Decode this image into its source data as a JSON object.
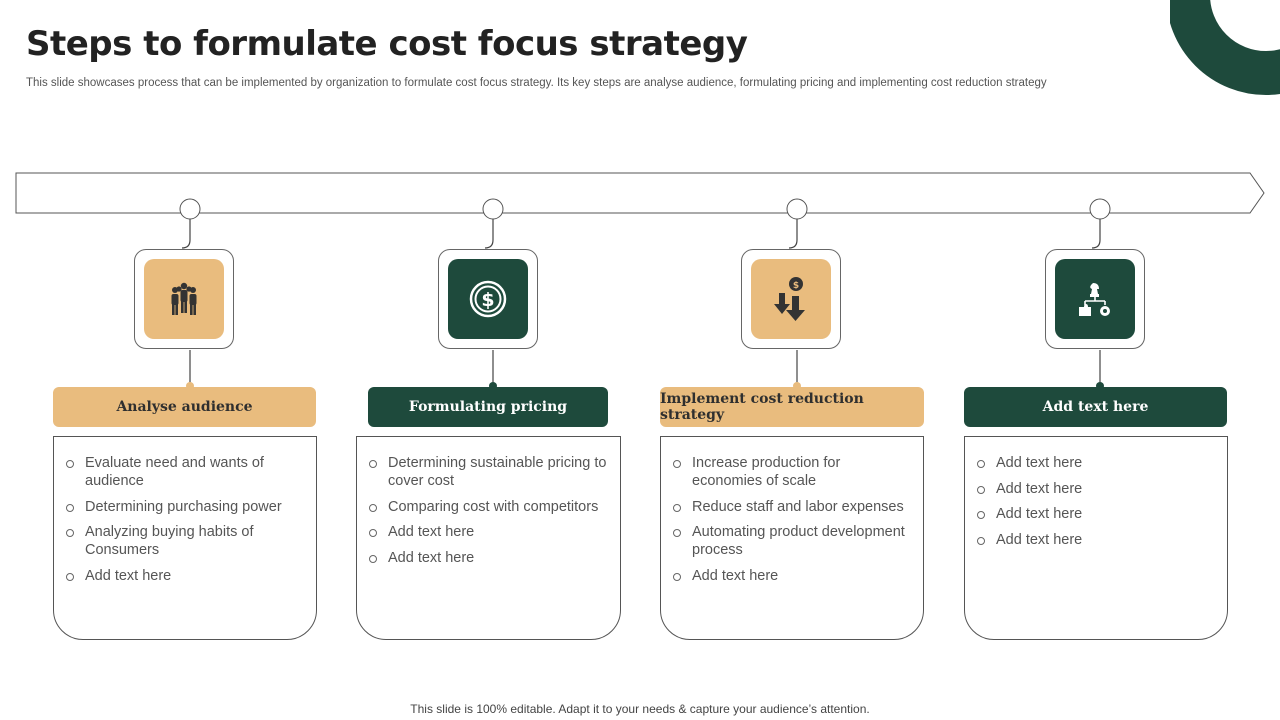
{
  "slide": {
    "title": "Steps to formulate cost focus strategy",
    "subtitle": "This slide showcases process that can be implemented by organization to formulate cost focus strategy. Its key steps are analyse audience, formulating pricing and implementing cost reduction strategy",
    "footer": "This slide is 100% editable. Adapt it to your needs & capture your audience’s attention."
  },
  "colors": {
    "tan": "#e9bc7e",
    "green": "#1e4a3c"
  },
  "steps": [
    {
      "label": "Analyse audience",
      "icon": "team-icon",
      "items": [
        "Evaluate need and wants of audience",
        "Determining purchasing power",
        "Analyzing buying habits of Consumers",
        "Add text here"
      ]
    },
    {
      "label": "Formulating pricing",
      "icon": "dollar-coin-icon",
      "items": [
        "Determining sustainable pricing to cover cost",
        "Comparing cost with competitors",
        "Add text here",
        "Add text here"
      ]
    },
    {
      "label": "Implement cost reduction strategy",
      "icon": "cost-reduction-icon",
      "items": [
        "Increase production for economies of scale",
        "Reduce staff and labor expenses",
        "Automating product development process",
        "Add text here"
      ]
    },
    {
      "label": "Add text here",
      "icon": "strategy-icon",
      "items": [
        "Add text here",
        "Add text here",
        "Add text here",
        "Add text here"
      ]
    }
  ]
}
